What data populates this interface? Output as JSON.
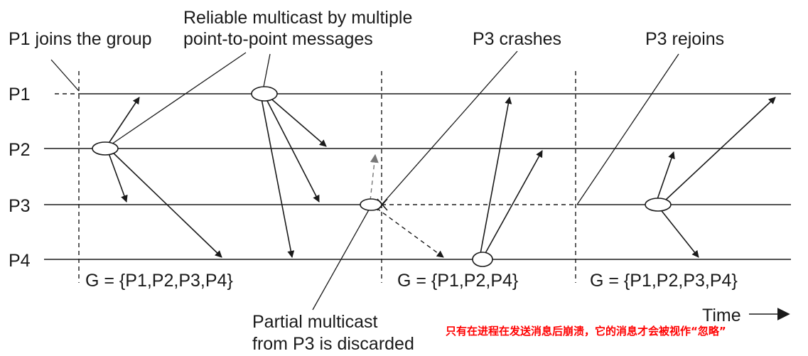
{
  "processes": [
    "P1",
    "P2",
    "P3",
    "P4"
  ],
  "labels": {
    "p1_joins": "P1 joins the group",
    "reliable_line1": "Reliable multicast by multiple",
    "reliable_line2": "point-to-point messages",
    "p3_crashes": "P3 crashes",
    "p3_rejoins": "P3 rejoins",
    "partial_line1": "Partial multicast",
    "partial_line2": "from P3 is discarded",
    "time": "Time"
  },
  "groups": [
    "G = {P1,P2,P3,P4}",
    "G = {P1,P2,P4}",
    "G = {P1,P2,P3,P4}"
  ],
  "note": "只有在进程在发送消息后崩溃，它的消息才会被视作“忽略”",
  "colors": {
    "ink": "#1a1a1a",
    "discarded": "#777777",
    "note": "#ff0000"
  }
}
